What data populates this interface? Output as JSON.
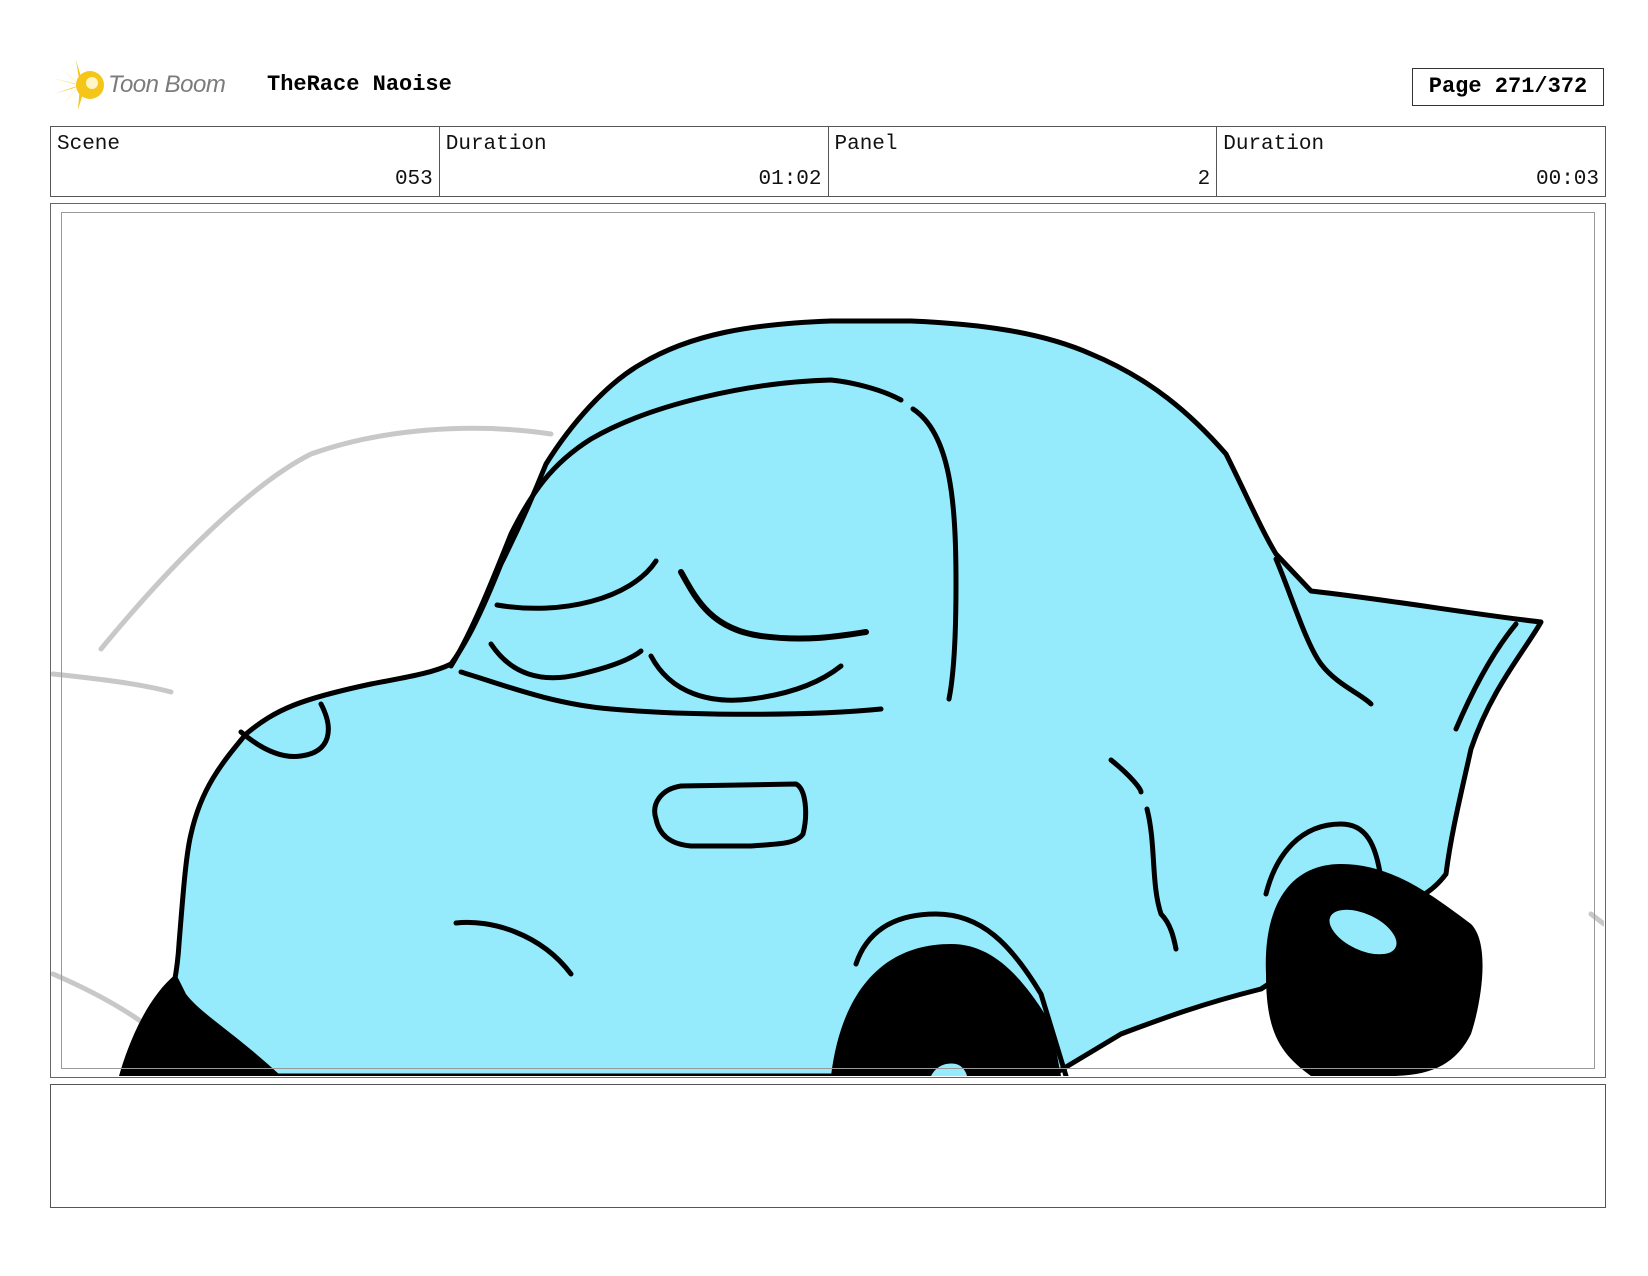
{
  "header": {
    "logo_text": "Toon Boom",
    "project_title": "TheRace Naoise",
    "page_label": "Page 271/372"
  },
  "info": {
    "scene_label": "Scene",
    "scene_value": "053",
    "scene_duration_label": "Duration",
    "scene_duration_value": "01:02",
    "panel_label": "Panel",
    "panel_value": "2",
    "panel_duration_label": "Duration",
    "panel_duration_value": "00:03"
  },
  "colors": {
    "car_body": "#95ebfc",
    "outline": "#000000",
    "sketch": "#c8c8c8",
    "logo_star": "#f5c518"
  },
  "icons": {
    "logo": "toon-boom-star-icon"
  },
  "notes": {
    "text": ""
  }
}
